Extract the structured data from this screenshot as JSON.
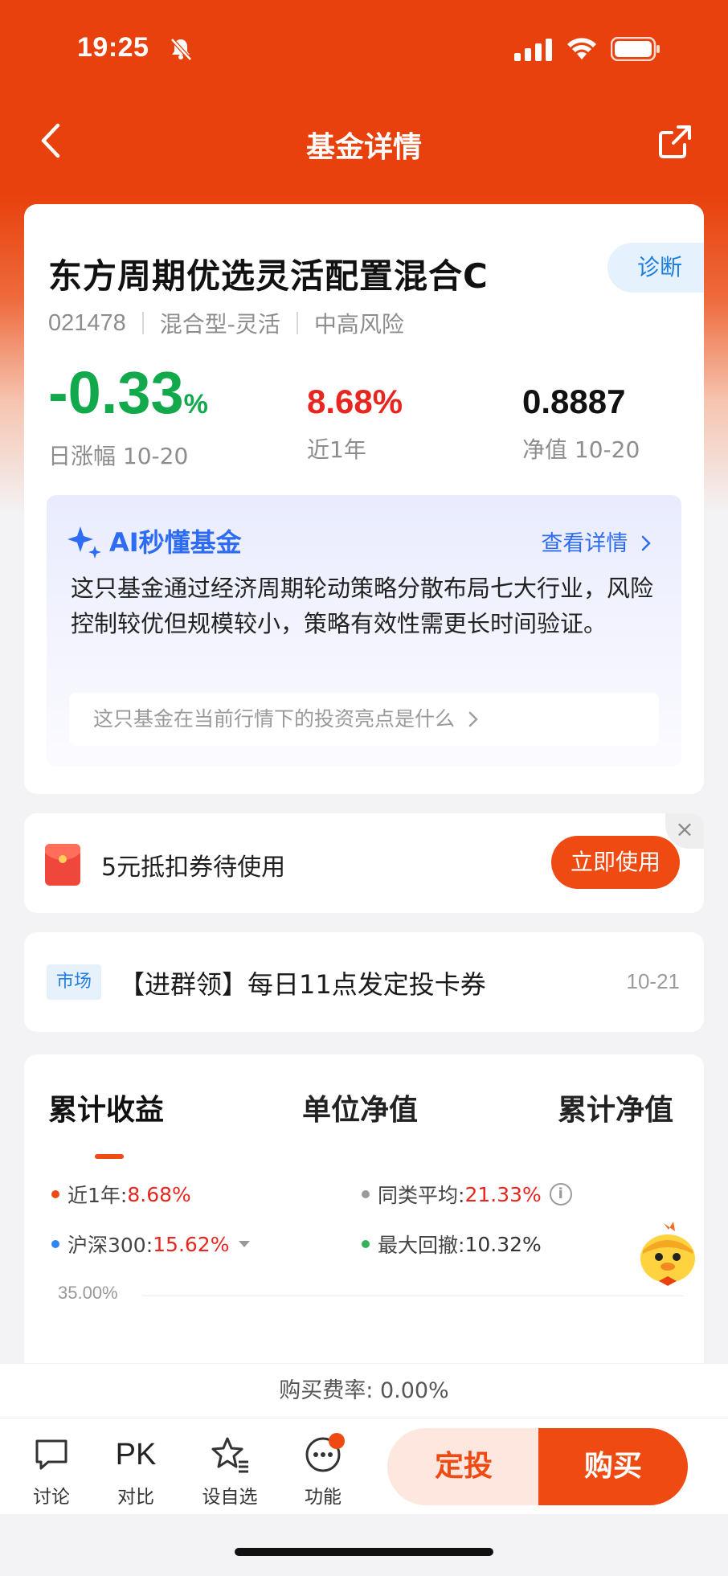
{
  "status_bar": {
    "time": "19:25"
  },
  "nav": {
    "title": "基金详情"
  },
  "fund": {
    "name": "东方周期优选灵活配置混合C",
    "diagnose_label": "诊断",
    "code": "021478",
    "type": "混合型-灵活",
    "risk": "中高风险",
    "daily_change": "-0.33",
    "daily_change_unit": "%",
    "daily_change_label": "日涨幅 10-20",
    "one_year": "8.68%",
    "one_year_label": "近1年",
    "nav_value": "0.8887",
    "nav_label": "净值 10-20"
  },
  "ai": {
    "title": "AI秒懂基金",
    "link": "查看详情",
    "text": "这只基金通过经济周期轮动策略分散布局七大行业，风险控制较优但规模较小，策略有效性需更长时间验证。",
    "question": "这只基金在当前行情下的投资亮点是什么"
  },
  "coupon": {
    "text": "5元抵扣券待使用",
    "button": "立即使用",
    "close": "×"
  },
  "news": {
    "tag": "市场",
    "text": "【进群领】每日11点发定投卡券",
    "date": "10-21"
  },
  "chart": {
    "tabs": [
      "累计收益",
      "单位净值",
      "累计净值"
    ],
    "legend": {
      "one_year_label": "近1年:",
      "one_year_value": "8.68%",
      "peer_label": "同类平均:",
      "peer_value": "21.33%",
      "hs300_label": "沪深300:",
      "hs300_value": "15.62%",
      "drawdown_label": "最大回撤:",
      "drawdown_value": "10.32%"
    },
    "y_top": "35.00%",
    "colors": {
      "one_year": "#ee4a12",
      "peer": "#9a9a9a",
      "hs300": "#2e86f0",
      "drawdown": "#36b35a"
    }
  },
  "fee": {
    "text": "购买费率: 0.00%"
  },
  "bottom_bar": {
    "discuss": "讨论",
    "pk_icon": "PK",
    "pk": "对比",
    "watch": "设自选",
    "func": "功能",
    "dingtou": "定投",
    "buy": "购买"
  },
  "colors": {
    "brand": "#e8410d",
    "up": "#e8261f",
    "down": "#12a94c",
    "accent_blue": "#2e6cf3"
  }
}
